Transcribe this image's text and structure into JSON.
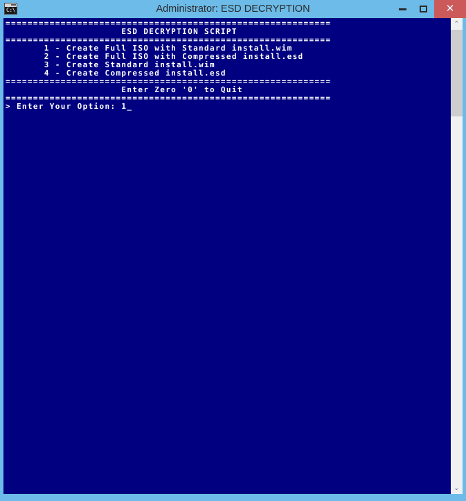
{
  "window": {
    "title": "Administrator:  ESD DECRYPTION",
    "icon_name": "cmd-console-icon",
    "icon_text": "C:\\",
    "colors": {
      "frame": "#6cbbe8",
      "console_bg": "#000080",
      "console_fg": "#ffffff",
      "close_button": "#cc5a5a",
      "title_text": "#2b2b2b",
      "scrollbar_track": "#f0f0f0",
      "scrollbar_thumb": "#cdcdcd"
    },
    "buttons": {
      "minimize_label": "–",
      "maximize_label": "□",
      "close_label": "✕"
    }
  },
  "console": {
    "separator": "===========================================================",
    "lines": [
      "===========================================================",
      "                     ESD DECRYPTION SCRIPT",
      "===========================================================",
      "       1 - Create Full ISO with Standard install.wim",
      "       2 - Create Full ISO with Compressed install.esd",
      "       3 - Create Standard install.wim",
      "       4 - Create Compressed install.esd",
      "===========================================================",
      "                     Enter Zero '0' to Quit",
      "===========================================================",
      "> Enter Your Option: 1_"
    ],
    "title_line": "ESD DECRYPTION SCRIPT",
    "menu_options": [
      {
        "key": "1",
        "label": "Create Full ISO with Standard install.wim"
      },
      {
        "key": "2",
        "label": "Create Full ISO with Compressed install.esd"
      },
      {
        "key": "3",
        "label": "Create Standard install.wim"
      },
      {
        "key": "4",
        "label": "Create Compressed install.esd"
      }
    ],
    "quit_hint": "Enter Zero '0' to Quit",
    "prompt": "> Enter Your Option: ",
    "typed_value": "1",
    "cursor": "_"
  },
  "scrollbar": {
    "up_arrow": "⌃",
    "down_arrow": "⌄"
  }
}
